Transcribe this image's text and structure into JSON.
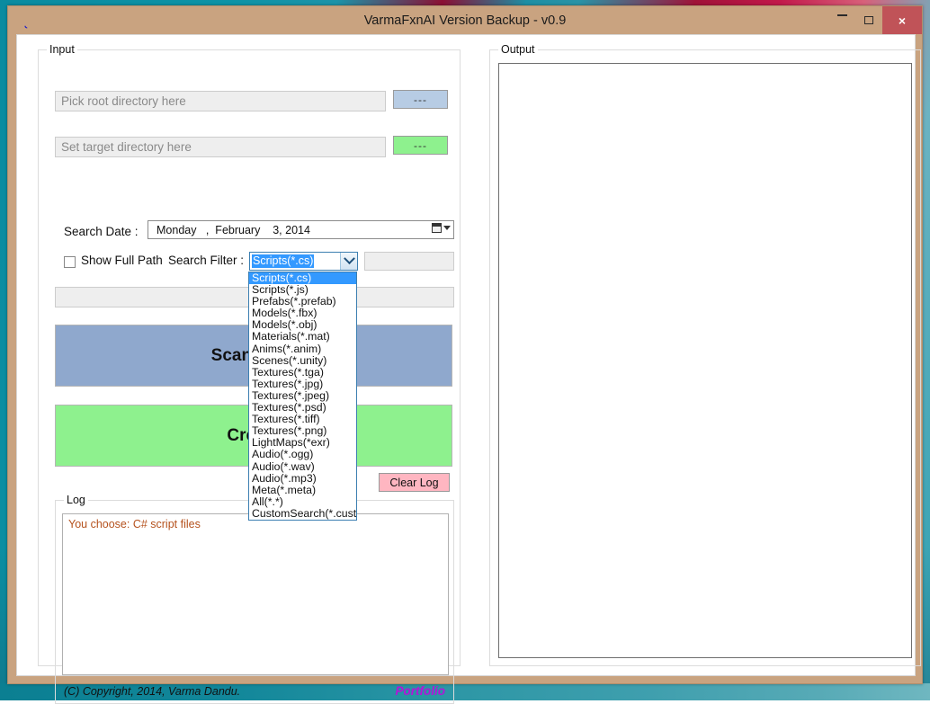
{
  "window": {
    "title": "VarmaFxnAI Version Backup - v0.9",
    "app_icon": "app-icon-y",
    "minimize_label": "–",
    "maximize_label": "□",
    "close_label": "×"
  },
  "input_group": {
    "title": "Input",
    "root_dir_placeholder": "Pick root directory here",
    "root_dir_value": "",
    "root_browse_label": "---",
    "target_dir_placeholder": "Set target directory here",
    "target_dir_value": "",
    "target_browse_label": "---",
    "search_date_label": "Search Date :",
    "search_date_value": "Monday   ,  February    3, 2014",
    "show_full_path_label": "Show Full Path",
    "show_full_path_checked": false,
    "search_filter_label": "Search Filter :",
    "filter_extra_value": "",
    "wide_disabled_value": ""
  },
  "combo": {
    "selected": "Scripts(*.cs)",
    "expanded": true,
    "options": [
      "Scripts(*.cs)",
      "Scripts(*.js)",
      "Prefabs(*.prefab)",
      "Models(*.fbx)",
      "Models(*.obj)",
      "Materials(*.mat)",
      "Anims(*.anim)",
      "Scenes(*.unity)",
      "Textures(*.tga)",
      "Textures(*.jpg)",
      "Textures(*.jpeg)",
      "Textures(*.psd)",
      "Textures(*.tiff)",
      "Textures(*.png)",
      "LightMaps(*exr)",
      "Audio(*.ogg)",
      "Audio(*.wav)",
      "Audio(*.mp3)",
      "Meta(*.meta)",
      "All(*.*)",
      "CustomSearch(*.customE"
    ]
  },
  "actions": {
    "scan_label": "Scan Total",
    "create_label": "Create",
    "clear_log_label": "Clear Log"
  },
  "log_group": {
    "title": "Log",
    "entries": "You choose:  C# script files",
    "copyright": "(C) Copyright, 2014, Varma Dandu.",
    "portfolio_label": "Portfolio"
  },
  "output_group": {
    "title": "Output",
    "content": ""
  },
  "colors": {
    "titlebar": "#c9a380",
    "close_button": "#c05358",
    "root_browse": "#b7cce4",
    "target_browse": "#8ef18e",
    "scan_button": "#8fa8cd",
    "create_button": "#8ef18e",
    "clear_log_button": "#ffb6c1",
    "log_text": "#b5521e",
    "portfolio_link": "#b315d8",
    "combo_highlight": "#3399ff"
  }
}
